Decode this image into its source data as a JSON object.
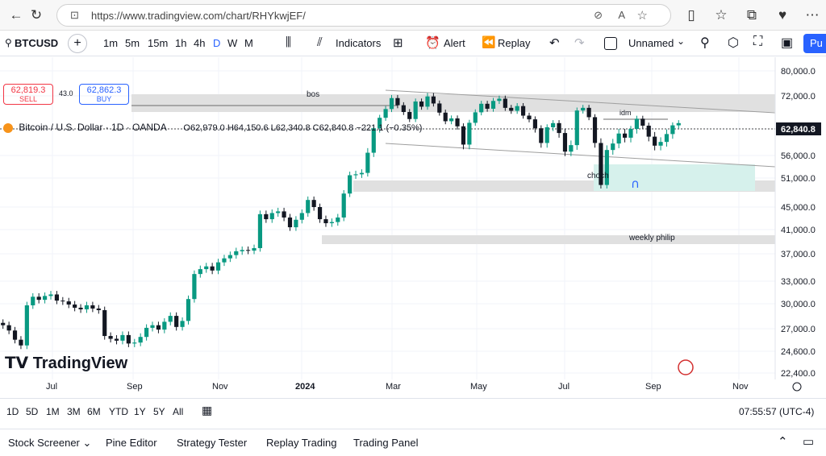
{
  "browser": {
    "url": "https://www.tradingview.com/chart/RHYkwjEF/"
  },
  "toolbar": {
    "symbol": "BTCUSD",
    "intervals": [
      "1m",
      "5m",
      "15m",
      "1h",
      "4h",
      "D",
      "W",
      "M"
    ],
    "indicators": "Indicators",
    "alert": "Alert",
    "replay": "Replay",
    "layout_name": "Unnamed",
    "publish": "Pu"
  },
  "legend": {
    "title": "Bitcoin / U.S. Dollar · 1D · OANDA",
    "ohlc": "O62,979.0 H64,150.6 L62,340.8 C62,840.8 −221.1 (−0.35%)",
    "sell_price": "62,819.3",
    "sell_label": "SELL",
    "spread": "43.0",
    "buy_price": "62,862.3",
    "buy_label": "BUY"
  },
  "annotations": {
    "bos": "bos",
    "idm": "idm",
    "choch": "choch",
    "weekly": "weekly philip"
  },
  "chart_data": {
    "type": "candlestick",
    "current_price": "62,840.8",
    "y_ticks": [
      "80,000.0",
      "72,000.0",
      "61,000.0",
      "56,000.0",
      "51,000.0",
      "45,000.0",
      "41,000.0",
      "37,000.0",
      "33,000.0",
      "30,000.0",
      "27,000.0",
      "24,600.0",
      "22,400.0"
    ],
    "x_ticks": [
      "Jul",
      "Sep",
      "Nov",
      "2024",
      "Mar",
      "May",
      "Jul",
      "Sep",
      "Nov"
    ],
    "closes": [
      27400,
      26800,
      25800,
      25200,
      29800,
      30900,
      30500,
      31000,
      31200,
      30400,
      30300,
      29900,
      29500,
      29300,
      29800,
      29400,
      29200,
      26200,
      25900,
      25700,
      26300,
      25400,
      25500,
      26100,
      27100,
      27400,
      26900,
      27800,
      28500,
      27200,
      27900,
      30600,
      34000,
      34700,
      35100,
      34500,
      35700,
      36300,
      36800,
      37400,
      37600,
      37500,
      37900,
      43700,
      42800,
      43900,
      44200,
      43100,
      41400,
      42700,
      43900,
      46400,
      45000,
      42800,
      42100,
      42300,
      43100,
      47700,
      51600,
      51800,
      52100,
      56500,
      61200,
      64500,
      67400,
      71200,
      68700,
      66400,
      64100,
      70000,
      68200,
      71800,
      69300,
      66200,
      63400,
      64300,
      61800,
      58000,
      62900,
      66300,
      69200,
      67500,
      70200,
      71000,
      67800,
      66800,
      68400,
      65200,
      64000,
      61200,
      58300,
      61500,
      62800,
      60200,
      56700,
      57900,
      66900,
      67800,
      64700,
      58300,
      49500,
      57000,
      58200,
      60100,
      59300,
      61000,
      64200,
      62000,
      59500,
      57800,
      58500,
      60000,
      62100,
      62800
    ]
  }
}
